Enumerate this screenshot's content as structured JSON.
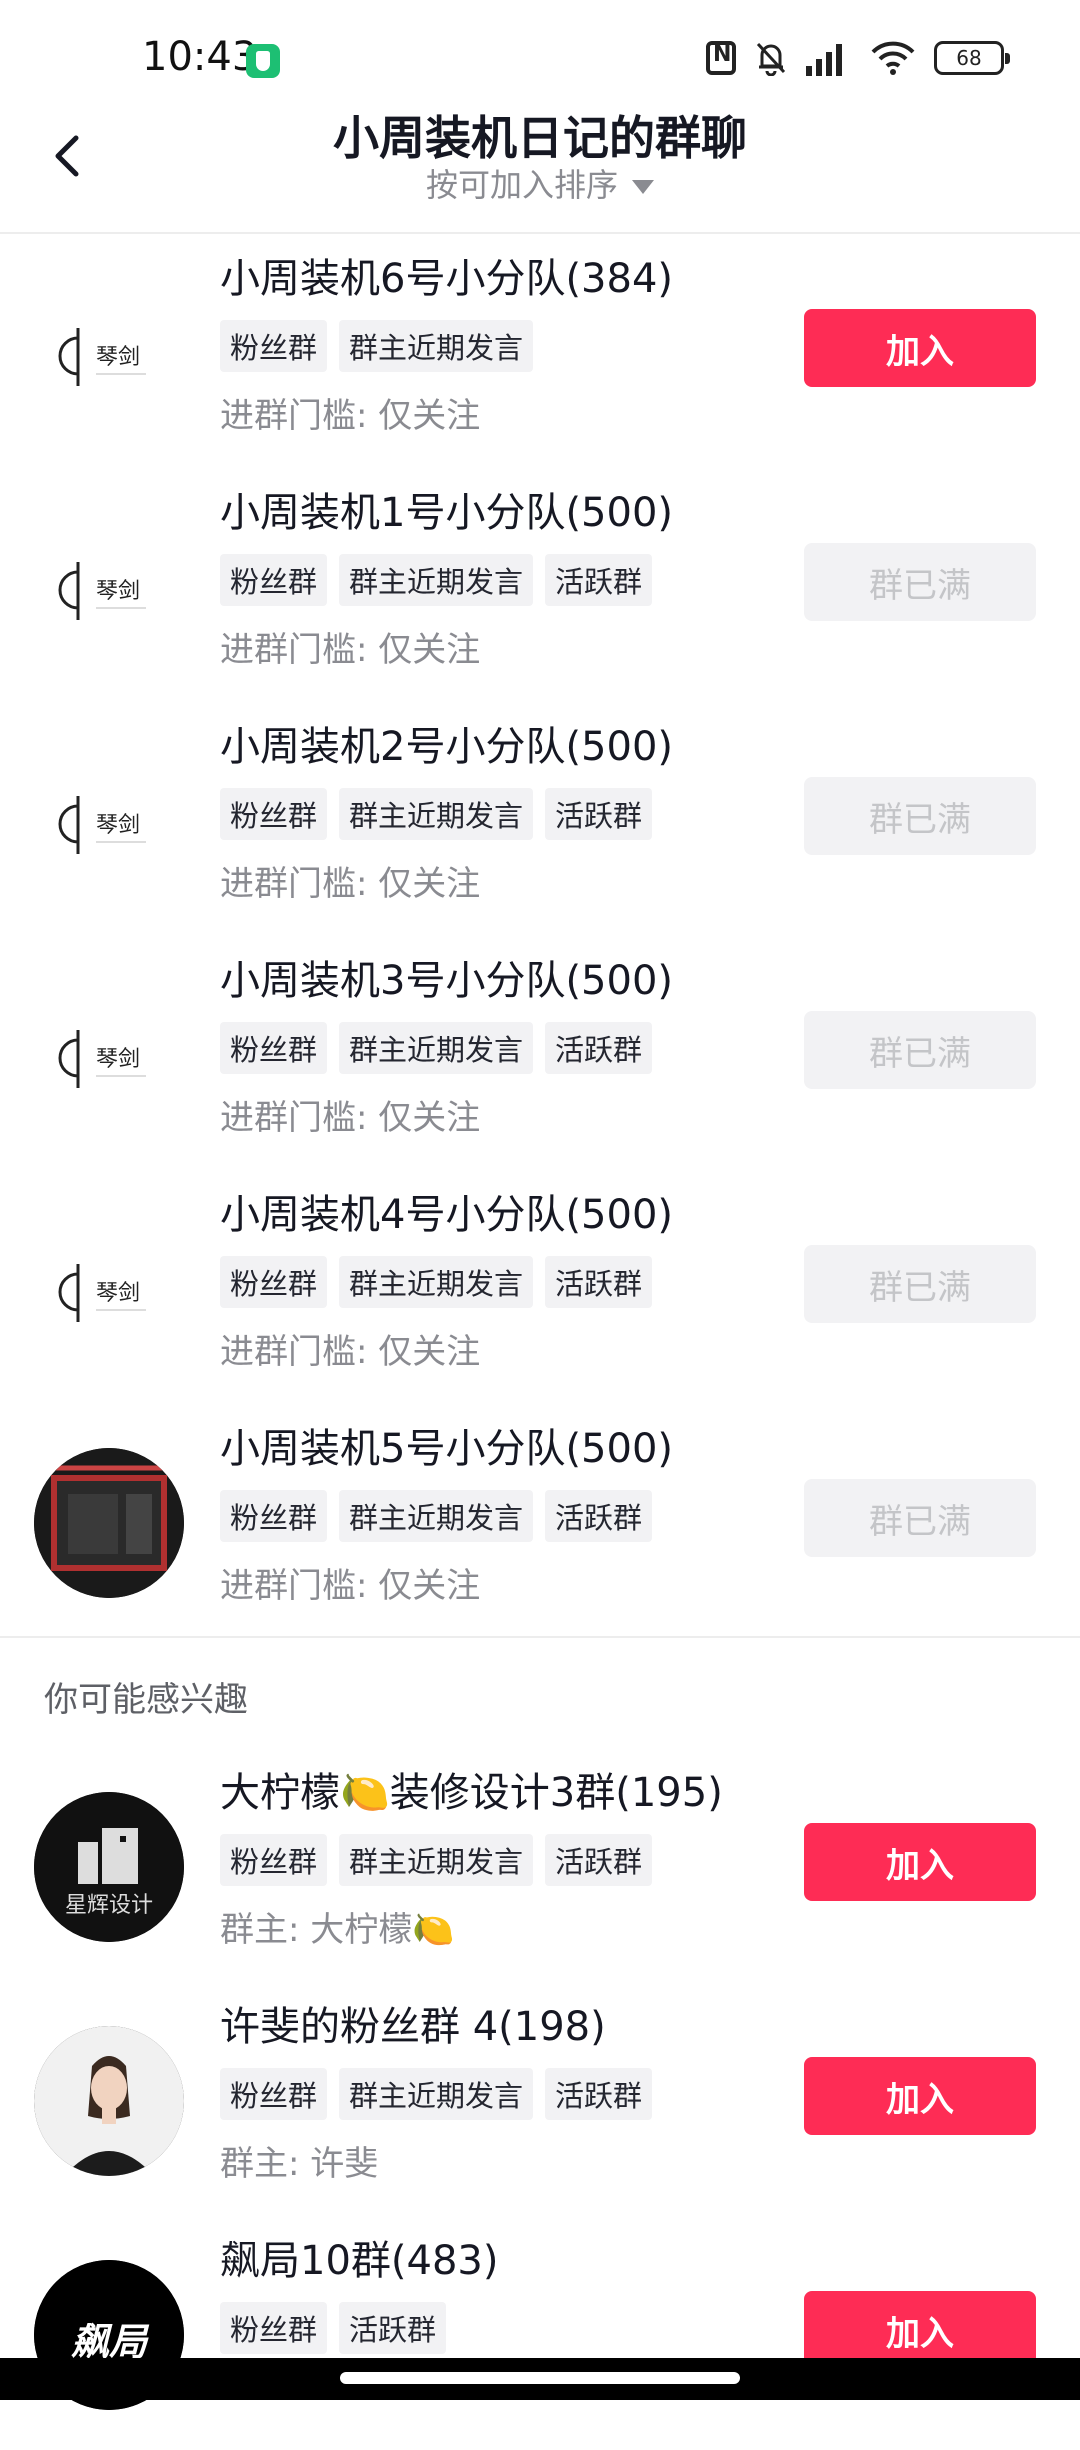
{
  "status_bar": {
    "time": "10:43",
    "battery": "68",
    "icons": [
      "shield-app-icon",
      "nfc-icon",
      "bell-muted-icon",
      "signal-icon",
      "wifi-icon",
      "battery-icon"
    ]
  },
  "header": {
    "title": "小周装机日记的群聊",
    "sort_label": "按可加入排序",
    "icons": [
      "back-arrow-icon",
      "sort-dropdown-icon"
    ]
  },
  "groups": [
    {
      "name": "小周装机6号小分队(384)",
      "tags": [
        "粉丝群",
        "群主近期发言"
      ],
      "meta": "进群门槛: 仅关注",
      "button": "加入",
      "avatar": "qinjian-logo"
    },
    {
      "name": "小周装机1号小分队(500)",
      "tags": [
        "粉丝群",
        "群主近期发言",
        "活跃群"
      ],
      "meta": "进群门槛: 仅关注",
      "button": "群已满",
      "avatar": "qinjian-logo"
    },
    {
      "name": "小周装机2号小分队(500)",
      "tags": [
        "粉丝群",
        "群主近期发言",
        "活跃群"
      ],
      "meta": "进群门槛: 仅关注",
      "button": "群已满",
      "avatar": "qinjian-logo"
    },
    {
      "name": "小周装机3号小分队(500)",
      "tags": [
        "粉丝群",
        "群主近期发言",
        "活跃群"
      ],
      "meta": "进群门槛: 仅关注",
      "button": "群已满",
      "avatar": "qinjian-logo"
    },
    {
      "name": "小周装机4号小分队(500)",
      "tags": [
        "粉丝群",
        "群主近期发言",
        "活跃群"
      ],
      "meta": "进群门槛: 仅关注",
      "button": "群已满",
      "avatar": "qinjian-logo"
    },
    {
      "name": "小周装机5号小分队(500)",
      "tags": [
        "粉丝群",
        "群主近期发言",
        "活跃群"
      ],
      "meta": "进群门槛: 仅关注",
      "button": "群已满",
      "avatar": "pc-case-photo"
    }
  ],
  "avatar_logo_text": "琴剑",
  "recommend": {
    "title": "你可能感兴趣",
    "groups": [
      {
        "name": "大柠檬🍋装修设计3群(195)",
        "tags": [
          "粉丝群",
          "群主近期发言",
          "活跃群"
        ],
        "meta": "群主: 大柠檬🍋",
        "button": "加入",
        "avatar": "building-logo",
        "avatar_text": "星辉设计"
      },
      {
        "name": "许斐的粉丝群 4(198)",
        "tags": [
          "粉丝群",
          "群主近期发言",
          "活跃群"
        ],
        "meta": "群主: 许斐",
        "button": "加入",
        "avatar": "person-photo"
      },
      {
        "name": "飙局10群(483)",
        "tags": [
          "粉丝群",
          "活跃群"
        ],
        "meta": "",
        "button": "加入",
        "avatar": "calligraphy-logo",
        "avatar_text": "飙局"
      }
    ]
  },
  "colors": {
    "accent": "#fe2c55",
    "tag_bg": "#f2f2f4",
    "muted": "#8a8b91",
    "disabled_text": "#c4c5c8"
  }
}
